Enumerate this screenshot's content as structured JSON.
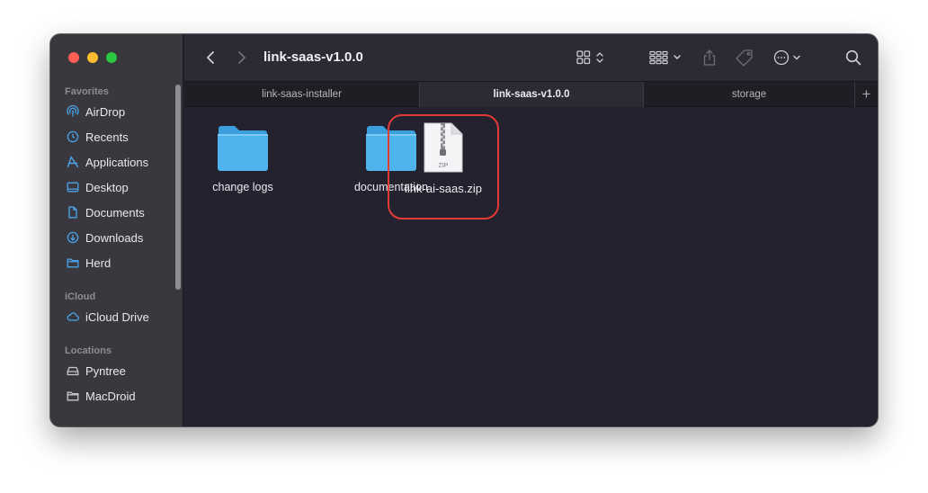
{
  "window": {
    "title": "link-saas-v1.0.0"
  },
  "sidebar": {
    "sections": [
      {
        "label": "Favorites",
        "items": [
          {
            "label": "AirDrop",
            "icon": "airdrop-icon"
          },
          {
            "label": "Recents",
            "icon": "clock-icon"
          },
          {
            "label": "Applications",
            "icon": "applications-icon"
          },
          {
            "label": "Desktop",
            "icon": "desktop-icon"
          },
          {
            "label": "Documents",
            "icon": "document-icon"
          },
          {
            "label": "Downloads",
            "icon": "download-icon"
          },
          {
            "label": "Herd",
            "icon": "folder-icon"
          }
        ]
      },
      {
        "label": "iCloud",
        "items": [
          {
            "label": "iCloud Drive",
            "icon": "cloud-icon"
          }
        ]
      },
      {
        "label": "Locations",
        "items": [
          {
            "label": "Pyntree",
            "icon": "drive-icon"
          },
          {
            "label": "MacDroid",
            "icon": "folder-icon"
          }
        ]
      }
    ]
  },
  "tabs": [
    {
      "label": "link-saas-installer",
      "active": false
    },
    {
      "label": "link-saas-v1.0.0",
      "active": true
    },
    {
      "label": "storage",
      "active": false
    }
  ],
  "files": [
    {
      "name": "change logs",
      "kind": "folder"
    },
    {
      "name": "documentation",
      "kind": "folder"
    },
    {
      "name": "link-ai-saas.zip",
      "kind": "zip",
      "badge": "ZIP",
      "highlighted": true
    }
  ],
  "colors": {
    "folder": "#4fb3ec",
    "highlight": "#e23a36",
    "accent": "#4aa3e8"
  }
}
